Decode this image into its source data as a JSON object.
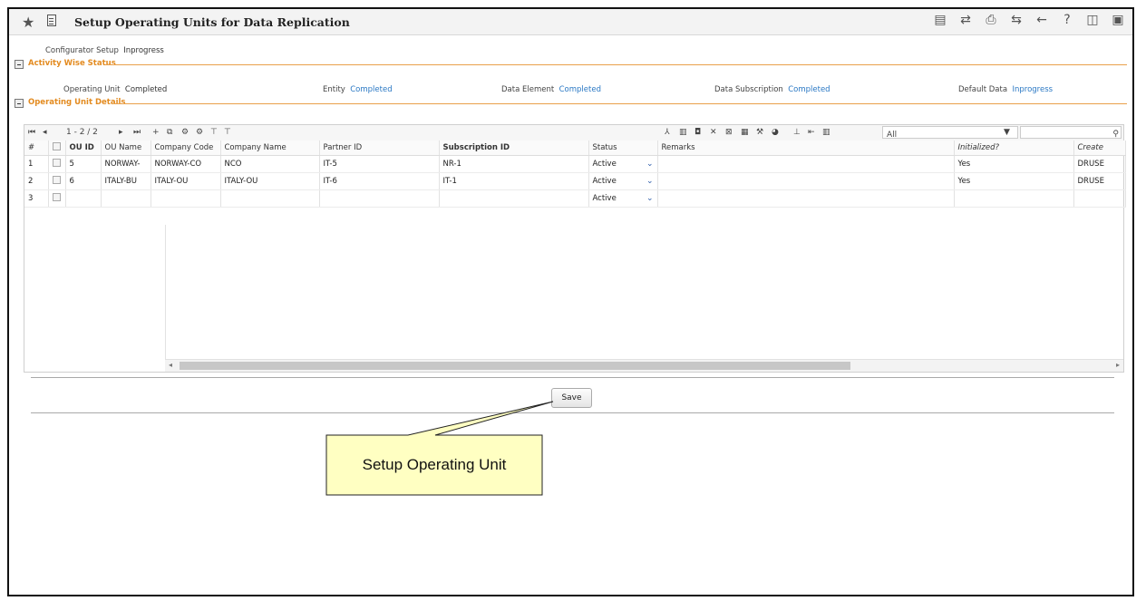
{
  "window": {
    "title": "Setup Operating Units for Data Replication",
    "toolbar_icons": [
      "report-icon",
      "shuffle-icon",
      "print-icon",
      "transfer-icon",
      "back-icon",
      "help-icon",
      "settings-window-icon",
      "minimize-icon"
    ]
  },
  "configurator": {
    "label": "Configurator Setup",
    "value": "Inprogress"
  },
  "activity_section": {
    "title": "Activity Wise Status"
  },
  "statuses": [
    {
      "label": "Operating Unit",
      "value": "Completed"
    },
    {
      "label": "Entity",
      "value": "Completed"
    },
    {
      "label": "Data Element",
      "value": "Completed"
    },
    {
      "label": "Data Subscription",
      "value": "Completed"
    },
    {
      "label": "Default Data",
      "value": "Inprogress"
    }
  ],
  "details_section": {
    "title": "Operating Unit Details"
  },
  "pager": {
    "text": "1 - 2 / 2"
  },
  "filter": {
    "value": "All"
  },
  "grid": {
    "columns": [
      "#",
      "",
      "OU ID",
      "OU Name",
      "Company Code",
      "Company Name",
      "Partner ID",
      "Subscription ID",
      "Status",
      "Remarks",
      "Initialized?",
      "Create"
    ],
    "rows": [
      {
        "n": "1",
        "ou_id": "5",
        "ou_name": "NORWAY-",
        "company_code": "NORWAY-CO",
        "company_name": "NCO",
        "partner_id": "IT-5",
        "subscription_id": "NR-1",
        "status": "Active",
        "remarks": "",
        "initialized": "Yes",
        "create": "DRUSE"
      },
      {
        "n": "2",
        "ou_id": "6",
        "ou_name": "ITALY-BU",
        "company_code": "ITALY-OU",
        "company_name": "ITALY-OU",
        "partner_id": "IT-6",
        "subscription_id": "IT-1",
        "status": "Active",
        "remarks": "",
        "initialized": "Yes",
        "create": "DRUSE"
      },
      {
        "n": "3",
        "ou_id": "",
        "ou_name": "",
        "company_code": "",
        "company_name": "",
        "partner_id": "",
        "subscription_id": "",
        "status": "Active",
        "remarks": "",
        "initialized": "",
        "create": ""
      }
    ]
  },
  "actions": {
    "save_label": "Save"
  },
  "callout": {
    "text": "Setup Operating Unit"
  },
  "colors": {
    "accent_orange": "#e38b20",
    "link_blue": "#2a78c4"
  }
}
